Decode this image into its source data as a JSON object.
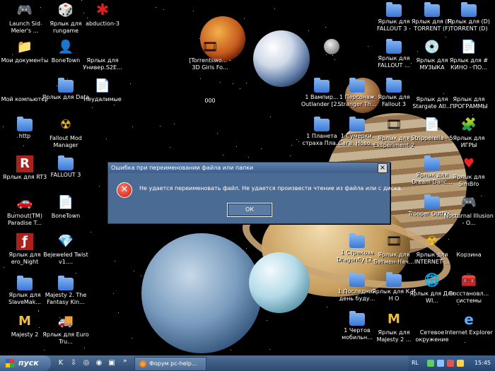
{
  "desktop_icons": [
    {
      "label": "Launch Sid Meier's ...",
      "icon": "game-icon",
      "glyph": "🎮"
    },
    {
      "label": "Ярлык для rungame",
      "icon": "game-icon",
      "glyph": "🎲"
    },
    {
      "label": "abduction-3",
      "icon": "red-splash-icon",
      "glyph": "✱"
    },
    {
      "label": "Мои документы",
      "icon": "my-documents-icon",
      "glyph": "📁"
    },
    {
      "label": "BoneTown",
      "icon": "character-icon",
      "glyph": "👤"
    },
    {
      "label": "Ярлык для Универ.S2E...",
      "icon": "video-file-icon",
      "glyph": "🎞"
    },
    {
      "label": "Мой компьютер",
      "icon": "computer-icon",
      "glyph": "🖥"
    },
    {
      "label": "Ярлык для Data",
      "icon": "folder-icon",
      "glyph": ""
    },
    {
      "label": "Неудалимые",
      "icon": "document-icon",
      "glyph": "📄"
    },
    {
      "label": "http",
      "icon": "folder-icon",
      "glyph": ""
    },
    {
      "label": "Fallout Mod Manager",
      "icon": "fallout-icon",
      "glyph": "☢"
    },
    {
      "label": "Ярлык для RT3",
      "icon": "rt3-icon",
      "glyph": "R"
    },
    {
      "label": "FALLOUT 3",
      "icon": "folder-icon",
      "glyph": ""
    },
    {
      "label": "Burnout(TM) Paradise T...",
      "icon": "game-icon",
      "glyph": "🚗"
    },
    {
      "label": "BoneTown",
      "icon": "document-icon",
      "glyph": "📄"
    },
    {
      "label": "Ярлык для ero_Night",
      "icon": "flash-icon",
      "glyph": "ƒ"
    },
    {
      "label": "Bejeweled Twist v1....",
      "icon": "gem-icon",
      "glyph": "💎"
    },
    {
      "label": "Ярлык для SlaveMak...",
      "icon": "folder-icon",
      "glyph": ""
    },
    {
      "label": "Majesty 2. The Fantasy Kin...",
      "icon": "folder-icon",
      "glyph": ""
    },
    {
      "label": "Majesty 2",
      "icon": "majesty-icon",
      "glyph": "M"
    },
    {
      "label": "Ярлык для Euro Tru...",
      "icon": "truck-icon",
      "glyph": "🚚"
    },
    {
      "label": "[Torrentswo... - 3D Girls Fo...",
      "icon": "video-file-icon",
      "glyph": "🎞"
    },
    {
      "label": "000",
      "icon": "video-file-icon",
      "glyph": "🎞"
    },
    {
      "label": "Ярлык для FALLOUT 3 -",
      "icon": "folder-icon",
      "glyph": ""
    },
    {
      "label": "Ярлык для (F) TORRENT (F)",
      "icon": "folder-icon",
      "glyph": ""
    },
    {
      "label": "Ярлык для (D) TORRENT (D)",
      "icon": "folder-icon",
      "glyph": ""
    },
    {
      "label": "Ярлык для FALLOUT ...",
      "icon": "folder-icon",
      "glyph": ""
    },
    {
      "label": "Ярлык для МУЗЫКА",
      "icon": "music-cd-icon",
      "glyph": "💿"
    },
    {
      "label": "Ярлык для # КИНО - ПО...",
      "icon": "document-icon",
      "glyph": "📄"
    },
    {
      "label": "1 Вампир... Outlander [2...",
      "icon": "folder-icon",
      "glyph": ""
    },
    {
      "label": "1 Персонаж Stranger Th...",
      "icon": "folder-icon",
      "glyph": ""
    },
    {
      "label": "Ярлык для Fallout 3",
      "icon": "folder-icon",
      "glyph": ""
    },
    {
      "label": "Ярлык для Stargate Atl...",
      "icon": "video-file-icon",
      "glyph": "🎞"
    },
    {
      "label": "Ярлык для ПРОГРАММЫ",
      "icon": "tools-icon",
      "glyph": "🛠"
    },
    {
      "label": "1 Планета страха Пла...",
      "icon": "folder-icon",
      "glyph": ""
    },
    {
      "label": "1 Сумерки. Сага. Ново...",
      "icon": "folder-icon",
      "glyph": ""
    },
    {
      "label": "Ярлык для Eksperiment-2",
      "icon": "video-file-icon",
      "glyph": "🎞"
    },
    {
      "label": "Stripperella - 5",
      "icon": "document-icon",
      "glyph": "📄"
    },
    {
      "label": "Ярлык для ИГРЫ",
      "icon": "puzzle-icon",
      "glyph": "🧩"
    },
    {
      "label": "Ярлык для Dream Danc...",
      "icon": "folder-icon",
      "glyph": ""
    },
    {
      "label": "Ярлык для SimBro",
      "icon": "heart-icon",
      "glyph": "♥"
    },
    {
      "label": "Trooper Outfits...",
      "icon": "folder-icon",
      "glyph": ""
    },
    {
      "label": "Nocturnal Illusion - O...",
      "icon": "game-icon",
      "glyph": "🎮"
    },
    {
      "label": "1 Стрекоза Dragonfly [2...",
      "icon": "folder-icon",
      "glyph": ""
    },
    {
      "label": "Ярлык для Бэтмен-Нач...",
      "icon": "video-file-icon",
      "glyph": "🎞"
    },
    {
      "label": "Ярлык для INTERNET ...",
      "icon": "radiation-icon",
      "glyph": "☢"
    },
    {
      "label": "Корзина",
      "icon": "recycle-bin-icon",
      "glyph": "🗑"
    },
    {
      "label": "1 Последний день буду...",
      "icon": "folder-icon",
      "glyph": ""
    },
    {
      "label": "Ярлык для К И Н О",
      "icon": "folder-icon",
      "glyph": ""
    },
    {
      "label": "Ярлык для Для WI...",
      "icon": "windows-update-icon",
      "glyph": "🌐"
    },
    {
      "label": "Восстановл... системы",
      "icon": "system-restore-icon",
      "glyph": "🧰"
    },
    {
      "label": "1 Чертов мобильн...",
      "icon": "folder-icon",
      "glyph": ""
    },
    {
      "label": "Ярлык для Majesty 2 ...",
      "icon": "majesty-icon",
      "glyph": "M"
    },
    {
      "label": "Сетевое окружение",
      "icon": "network-icon",
      "glyph": "🖧"
    },
    {
      "label": "Internet Explorer",
      "icon": "internet-explorer-icon",
      "glyph": "e"
    }
  ],
  "dialog": {
    "title": "Ошибка при переименовании файла или папки",
    "close_label": "×",
    "error_icon": "error-icon",
    "error_glyph": "✕",
    "message": "Не удается переименовать файл. Не удается произвести чтение из файла или с диска.",
    "ok_label": "ОК"
  },
  "taskbar": {
    "start_label": "пуск",
    "chevron": "»",
    "quick_launch": [
      {
        "icon": "kaspersky-icon",
        "glyph": "K"
      },
      {
        "icon": "download-icon",
        "glyph": "⇩"
      },
      {
        "icon": "globe-icon",
        "glyph": "◎"
      },
      {
        "icon": "firefox-icon",
        "glyph": "◉"
      },
      {
        "icon": "desktop-icon",
        "glyph": "▣"
      }
    ],
    "window_button": "Форум pc-help...",
    "tray": {
      "language": "RL",
      "clock": "15:45"
    }
  },
  "colors": {
    "dialog_bg": "#4a6b93",
    "taskbar": "#3a5a82",
    "error": "#d0180c"
  }
}
